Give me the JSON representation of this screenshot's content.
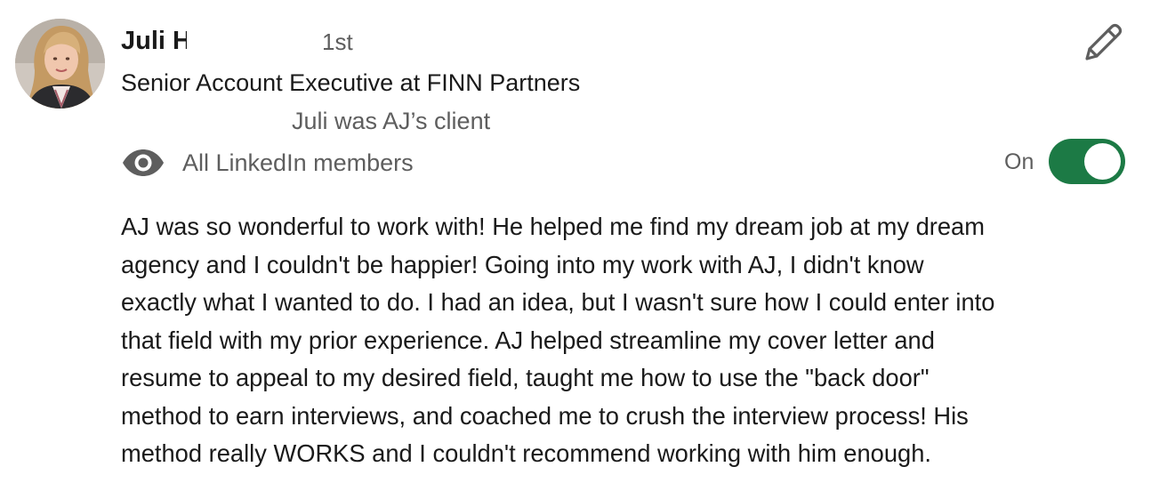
{
  "recommendation": {
    "author": {
      "name": "Juli H",
      "connection_degree": "1st",
      "headline": "Senior Account Executive at FINN Partners",
      "relationship": "Juli was AJ’s client",
      "avatar_icon": "profile-photo"
    },
    "visibility": {
      "icon": "eye-icon",
      "label": "All LinkedIn members",
      "toggle_label": "On",
      "toggle_on": true,
      "toggle_color": "#1c7a45"
    },
    "edit_icon": "pencil-icon",
    "text_lines": [
      "AJ was so wonderful to work with! He helped me find my dream job at my dream",
      "agency and I couldn't be happier! Going into my work with AJ, I didn't know",
      "exactly what I wanted to do. I had an idea, but I wasn't sure how I could enter into",
      "that field with my prior experience. AJ helped streamline my cover letter and",
      "resume to appeal to my desired field, taught me how to use the \"back door\"",
      "method to earn interviews, and coached me to crush the interview process! His",
      "method really WORKS and I couldn't recommend working with him enough."
    ]
  }
}
